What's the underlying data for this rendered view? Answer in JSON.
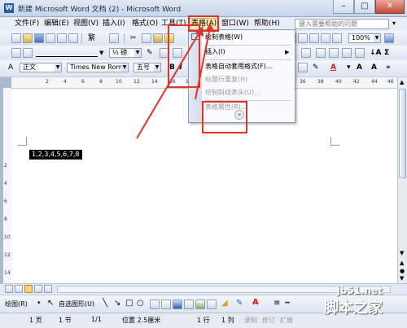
{
  "window": {
    "title": "新建 Microsoft Word 文档 (2) - Microsoft Word"
  },
  "window_buttons": {
    "minimize": "–",
    "maximize": "□",
    "close": "✕"
  },
  "menubar": {
    "items": [
      "文件(F)",
      "编辑(E)",
      "视图(V)",
      "插入(I)",
      "格式(O)",
      "工具(T)",
      "表格(A)",
      "窗口(W)",
      "帮助(H)"
    ],
    "help_placeholder": "键入需要帮助的问题"
  },
  "toolbar_standard": {
    "zoom": "100%",
    "ime_label": "繁"
  },
  "toolbar_drawing_fmt": {
    "line_weight": "½ 磅"
  },
  "toolbar_format": {
    "style": "正文",
    "font": "Times New Roman",
    "size": "五号",
    "bold": "B",
    "italic": "I"
  },
  "ruler": {
    "left_numbers": [
      "2",
      "4",
      "6",
      "8",
      "10",
      "12",
      "14",
      "16",
      "18"
    ],
    "right_numbers": [
      "36",
      "38",
      "40",
      "42",
      "44",
      "46"
    ],
    "vertical_numbers": [
      "2",
      "4",
      "6",
      "8",
      "10",
      "12",
      "14"
    ]
  },
  "document": {
    "text": "1,2,3,4,5,6,7,8"
  },
  "table_menu": {
    "items": [
      {
        "label": "绘制表格(W)",
        "enabled": true
      },
      {
        "label": "插入(I)",
        "enabled": true,
        "submenu": true
      },
      {
        "label": "表格自动套用格式(F)...",
        "enabled": true
      },
      {
        "label": "标题行重复(H)",
        "enabled": false
      },
      {
        "label": "绘制斜线表头(U)...",
        "enabled": false
      },
      {
        "label": "表格属性(R)...",
        "enabled": false
      }
    ],
    "expand_label": "»"
  },
  "drawing_toolbar": {
    "draw_label": "绘图(R)",
    "autoshape_label": "自选图形(U)"
  },
  "statusbar": {
    "page": "1 页",
    "section": "1 节",
    "page_of": "1/1",
    "position": "位置 2.5厘米",
    "line": "1 行",
    "column": "1 列",
    "rec": "录制",
    "trk": "修订",
    "ext": "扩展"
  },
  "watermark": {
    "url": "jb51.net",
    "text": "脚本之家"
  },
  "colors": {
    "annotation": "#e4312a",
    "highlight_menu": "#f9e7b2"
  }
}
